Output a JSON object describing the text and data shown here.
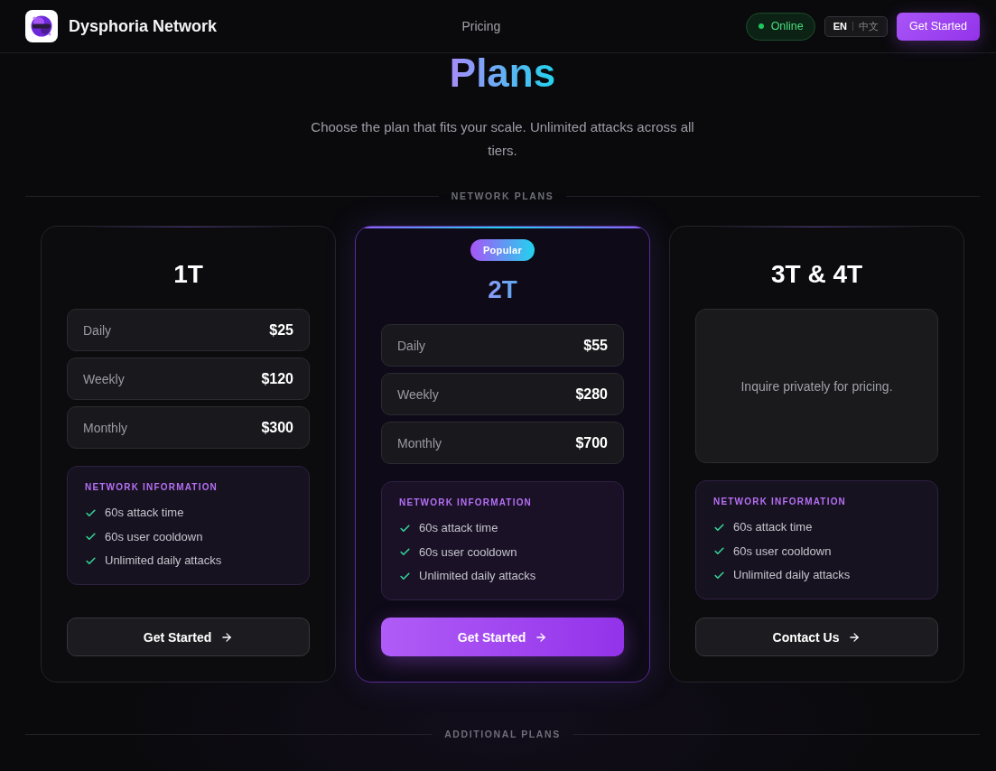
{
  "header": {
    "brand": "Dysphoria Network",
    "nav": [
      {
        "label": "Pricing"
      }
    ],
    "status": {
      "label": "Online",
      "on": true
    },
    "languages": [
      {
        "label": "EN",
        "selected": true
      },
      {
        "label": "中文",
        "selected": false
      }
    ],
    "cta": "Get Started"
  },
  "hero": {
    "title": "Plans",
    "subtitle": "Choose the plan that fits your scale. Unlimited attacks across all tiers."
  },
  "network_plans": {
    "label": "NETWORK PLANS",
    "plans": [
      {
        "name": "1T",
        "kind": "tiers",
        "featured": false,
        "prices": [
          {
            "period": "Daily",
            "price": "$25"
          },
          {
            "period": "Weekly",
            "price": "$120"
          },
          {
            "period": "Monthly",
            "price": "$300"
          }
        ],
        "info_title": "NETWORK INFORMATION",
        "features": [
          "60s attack time",
          "60s user cooldown",
          "Unlimited daily attacks"
        ],
        "button": "Get Started"
      },
      {
        "name": "2T",
        "kind": "tiers",
        "featured": true,
        "badge": "Popular",
        "prices": [
          {
            "period": "Daily",
            "price": "$55"
          },
          {
            "period": "Weekly",
            "price": "$280"
          },
          {
            "period": "Monthly",
            "price": "$700"
          }
        ],
        "info_title": "NETWORK INFORMATION",
        "features": [
          "60s attack time",
          "60s user cooldown",
          "Unlimited daily attacks"
        ],
        "button": "Get Started"
      },
      {
        "name": "3T & 4T",
        "kind": "inquiry",
        "featured": false,
        "note": "Inquire privately for pricing.",
        "info_title": "NETWORK INFORMATION",
        "features": [
          "60s attack time",
          "60s user cooldown",
          "Unlimited daily attacks"
        ],
        "button": "Contact Us"
      }
    ]
  },
  "additional_plans": {
    "label": "ADDITIONAL PLANS"
  }
}
